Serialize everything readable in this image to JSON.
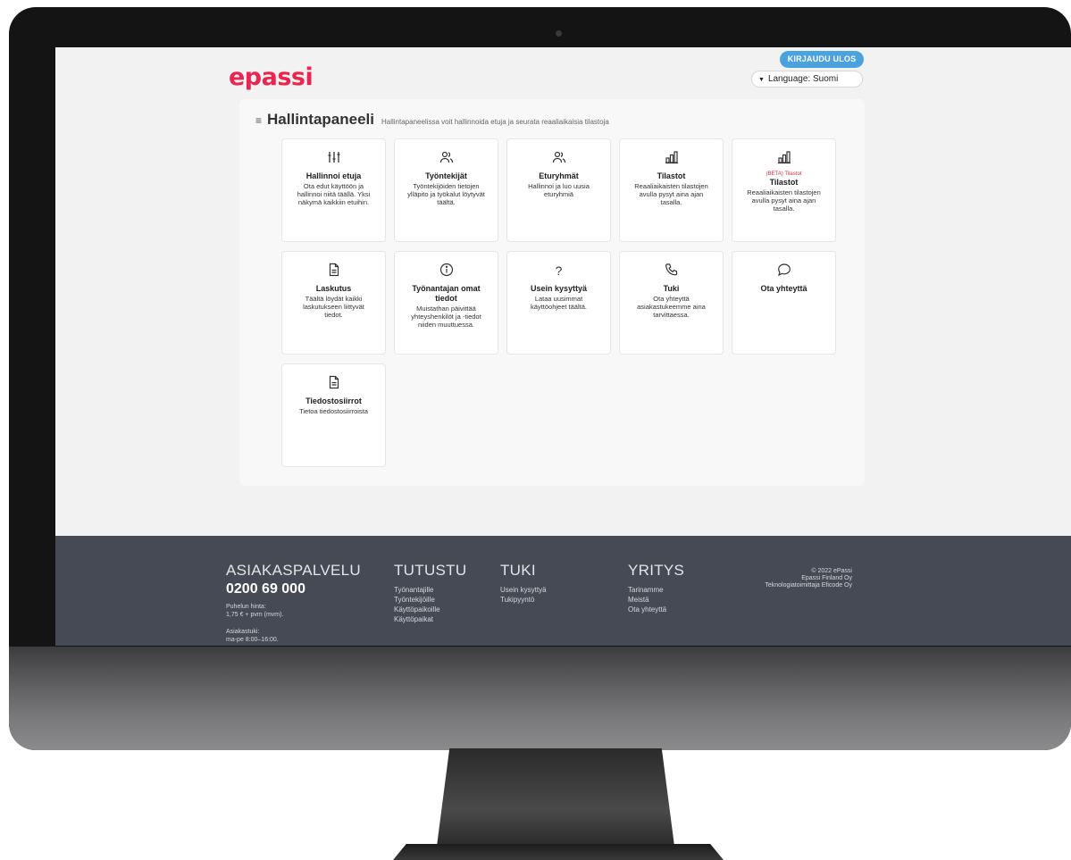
{
  "header": {
    "logo_text": "epassi",
    "logout_label": "KIRJAUDU ULOS",
    "language_label": "Language: Suomi"
  },
  "panel": {
    "title": "Hallintapaneeli",
    "subtitle": "Hallintapaneelissa voit hallinnoida etuja ja seurata reaaliaikaisia tilastoja",
    "cards": [
      {
        "icon": "sliders-icon",
        "title": "Hallinnoi etuja",
        "description": "Ota edut käyttöön ja hallinnoi niitä täällä. Yksi näkymä kaikkiin etuihin."
      },
      {
        "icon": "users-icon",
        "title": "Työntekijät",
        "description": "Työntekijöiden tietojen ylläpito ja työkalut löytyvät täältä."
      },
      {
        "icon": "users-icon",
        "title": "Eturyhmät",
        "description": "Hallinnoi ja luo uusia eturyhmiä"
      },
      {
        "icon": "bar-chart-icon",
        "title": "Tilastot",
        "description": "Reaaliaikaisten tilastojen avulla pysyt aina ajan tasalla."
      },
      {
        "icon": "bar-chart-icon",
        "badge": "(BETA) Tilastot",
        "title": "Tilastot",
        "description": "Reaaliaikaisten tilastojen avulla pysyt aina ajan tasalla."
      },
      {
        "icon": "document-icon",
        "title": "Laskutus",
        "description": "Täältä löydät kaikki laskutukseen liittyvät tiedot."
      },
      {
        "icon": "info-icon",
        "title": "Työnantajan omat tiedot",
        "description": "Muistathan päivittää yhteyshenkilöt ja -tiedot niiden muuttuessa."
      },
      {
        "icon": "question-icon",
        "icon_text": "?",
        "title": "Usein kysyttyä",
        "description": "Lataa uusimmat käyttöohjeet täältä."
      },
      {
        "icon": "phone-icon",
        "title": "Tuki",
        "description": "Ota yhteyttä asiakastukeemme aina tarvittaessa."
      },
      {
        "icon": "chat-bubble-icon",
        "title": "Ota yhteyttä",
        "description": ""
      },
      {
        "icon": "document-icon",
        "title": "Tiedostosiirrot",
        "description": "Tietoa tiedostosiirroista"
      }
    ]
  },
  "footer": {
    "service": {
      "heading": "ASIAKASPALVELU",
      "phone": "0200 69 000",
      "price_label": "Puhelun hinta:",
      "price": "1,75 € + pvm (mvm).",
      "support_label": "Asiakastuki:",
      "support_hours": "ma-pe 8:00–16:00."
    },
    "tutustu": {
      "heading": "TUTUSTU",
      "links": [
        "Työnantajille",
        "Työntekijöille",
        "Käyttöpaikoille",
        "Käyttöpaikat"
      ]
    },
    "tuki": {
      "heading": "TUKI",
      "links": [
        "Usein kysyttyä",
        "Tukipyyntö"
      ]
    },
    "yritys": {
      "heading": "YRITYS",
      "links": [
        "Tarinamme",
        "Meistä",
        "Ota yhteyttä"
      ]
    },
    "copyright": [
      "© 2022 ePassi",
      "Epassi Finland Oy",
      "Teknologiatoimittaja Eficode Oy"
    ]
  },
  "colors": {
    "brand": "#e8264f",
    "button": "#4aa3df",
    "footer_bg": "#454a54",
    "beta": "#e0303a"
  }
}
